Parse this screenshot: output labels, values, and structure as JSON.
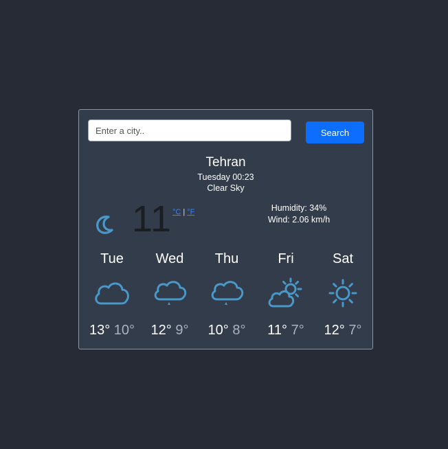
{
  "search": {
    "placeholder": "Enter a city..",
    "value": "",
    "button_label": "Search"
  },
  "current": {
    "city": "Tehran",
    "datetime": "Tuesday 00:23",
    "description": "Clear Sky",
    "temperature": "11",
    "unit_celsius": "°C",
    "unit_separator": "|",
    "unit_fahrenheit": "°F",
    "humidity": "Humidity: 34%",
    "wind": "Wind: 2.06 km/h",
    "icon": "moon-icon"
  },
  "forecast": [
    {
      "day": "Tue",
      "max": "13°",
      "min": "10°",
      "icon": "cloud-icon"
    },
    {
      "day": "Wed",
      "max": "12°",
      "min": "9°",
      "icon": "cloud-rain-icon"
    },
    {
      "day": "Thu",
      "max": "10°",
      "min": "8°",
      "icon": "cloud-rain-icon"
    },
    {
      "day": "Fri",
      "max": "11°",
      "min": "7°",
      "icon": "partly-cloudy-icon"
    },
    {
      "day": "Sat",
      "max": "12°",
      "min": "7°",
      "icon": "sun-icon"
    }
  ],
  "colors": {
    "background": "#262b35",
    "card": "#323c4a",
    "accent": "#0d6efd",
    "icon": "#4a98c9"
  }
}
